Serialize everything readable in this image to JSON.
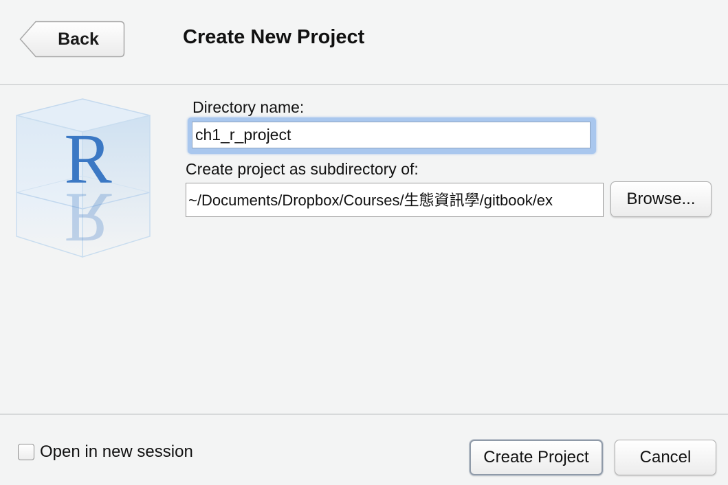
{
  "header": {
    "back_label": "Back",
    "title": "Create New Project"
  },
  "logo": {
    "letter": "R",
    "icon": "r-cube-logo",
    "color": "#3b78c4"
  },
  "form": {
    "directory_label": "Directory name:",
    "directory_value": "ch1_r_project",
    "parent_label": "Create project as subdirectory of:",
    "parent_path": "~/Documents/Dropbox/Courses/生態資訊學/gitbook/ex",
    "browse_label": "Browse..."
  },
  "footer": {
    "new_session_label": "Open in new session",
    "new_session_checked": false,
    "create_label": "Create Project",
    "cancel_label": "Cancel"
  },
  "colors": {
    "focus_ring": "#a9c7ee",
    "background": "#f3f4f4"
  }
}
